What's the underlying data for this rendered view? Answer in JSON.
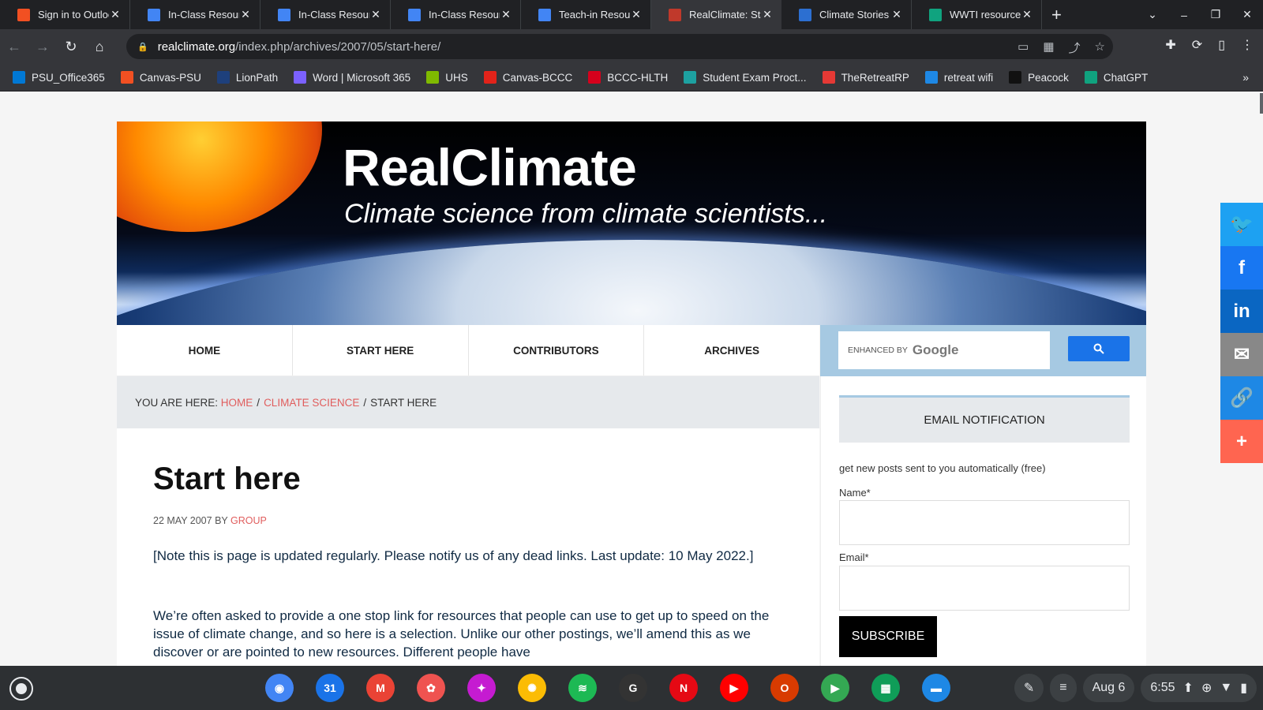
{
  "browser": {
    "tabs": [
      {
        "title": "Sign in to Outlook",
        "icon": "microsoft-icon",
        "active": false
      },
      {
        "title": "In-Class Resources",
        "icon": "docs-icon",
        "active": false
      },
      {
        "title": "In-Class Resources",
        "icon": "docs-icon",
        "active": false
      },
      {
        "title": "In-Class Resources",
        "icon": "docs-icon",
        "active": false
      },
      {
        "title": "Teach-in Resources",
        "icon": "docs-icon",
        "active": false
      },
      {
        "title": "RealClimate: Start here",
        "icon": "realclimate-icon",
        "active": true
      },
      {
        "title": "Climate Stories",
        "icon": "climate-stories-icon",
        "active": false
      },
      {
        "title": "WWTI resources",
        "icon": "chatgpt-icon",
        "active": false
      }
    ],
    "url_host": "realclimate.org",
    "url_path": "/index.php/archives/2007/05/start-here/",
    "bookmarks": [
      {
        "label": "PSU_Office365",
        "icon": "outlook-icon",
        "color": "#0078d4"
      },
      {
        "label": "Canvas-PSU",
        "icon": "microsoft-icon",
        "color": "#f25022"
      },
      {
        "label": "LionPath",
        "icon": "lionpath-icon",
        "color": "#1e407c"
      },
      {
        "label": "Word | Microsoft 365",
        "icon": "m365-icon",
        "color": "#7b61ff"
      },
      {
        "label": "UHS",
        "icon": "microsoft-icon",
        "color": "#7fba00"
      },
      {
        "label": "Canvas-BCCC",
        "icon": "canvas-icon",
        "color": "#e2231a"
      },
      {
        "label": "BCCC-HLTH",
        "icon": "mcgraw-hill-icon",
        "color": "#d6001c"
      },
      {
        "label": "Student Exam Proct...",
        "icon": "proctor-icon",
        "color": "#1da1a1"
      },
      {
        "label": "TheRetreatRP",
        "icon": "retreat-icon",
        "color": "#e53935"
      },
      {
        "label": "retreat wifi",
        "icon": "wifi-icon",
        "color": "#1e88e5"
      },
      {
        "label": "Peacock",
        "icon": "peacock-icon",
        "color": "#111111"
      },
      {
        "label": "ChatGPT",
        "icon": "chatgpt-icon",
        "color": "#10a37f"
      }
    ]
  },
  "site": {
    "title": "RealClimate",
    "tagline": "Climate science from climate scientists...",
    "nav": [
      "HOME",
      "START HERE",
      "CONTRIBUTORS",
      "ARCHIVES"
    ],
    "search_enhanced": "ENHANCED BY",
    "search_brand": "Google"
  },
  "breadcrumb": {
    "prefix": "YOU ARE HERE:",
    "home": "HOME",
    "category": "CLIMATE SCIENCE",
    "current": "START HERE"
  },
  "article": {
    "title": "Start here",
    "date": "22 MAY 2007",
    "by": "BY",
    "author": "GROUP",
    "paragraphs": [
      "[Note this is page is updated regularly. Please notify us of any dead links. Last update: 10 May 2022.]",
      "We’re often asked to provide a one stop link for resources that people can use to get up to speed on the issue of climate change, and so here is a selection. Unlike our other postings, we’ll amend this as we discover or are pointed to new resources. Different people have"
    ]
  },
  "sidebar": {
    "heading": "EMAIL NOTIFICATION",
    "description": "get new posts sent to you automatically (free)",
    "name_label": "Name*",
    "email_label": "Email*",
    "subscribe": "SUBSCRIBE"
  },
  "share_buttons": [
    {
      "icon": "twitter-icon",
      "color": "#1da1f2"
    },
    {
      "icon": "facebook-icon",
      "color": "#1877f2"
    },
    {
      "icon": "linkedin-icon",
      "color": "#0a66c2"
    },
    {
      "icon": "email-icon",
      "color": "#888888"
    },
    {
      "icon": "link-icon",
      "color": "#1e88e5"
    },
    {
      "icon": "plus-icon",
      "color": "#ff6550"
    }
  ],
  "shelf": {
    "apps": [
      {
        "icon": "chrome-icon",
        "color": "#4285f4"
      },
      {
        "icon": "calendar-icon",
        "color": "#1a73e8"
      },
      {
        "icon": "gmail-icon",
        "color": "#ea4335"
      },
      {
        "icon": "paint-icon",
        "color": "#ef5350"
      },
      {
        "icon": "gallery-icon",
        "color": "#c51bd1"
      },
      {
        "icon": "photos-icon",
        "color": "#fbbc04"
      },
      {
        "icon": "spotify-icon",
        "color": "#1db954"
      },
      {
        "icon": "grammarly-icon",
        "color": "#333333"
      },
      {
        "icon": "netflix-icon",
        "color": "#e50914"
      },
      {
        "icon": "youtube-icon",
        "color": "#ff0000"
      },
      {
        "icon": "office-icon",
        "color": "#d83b01"
      },
      {
        "icon": "play-store-icon",
        "color": "#34a853"
      },
      {
        "icon": "sheets-icon",
        "color": "#0f9d58"
      },
      {
        "icon": "files-icon",
        "color": "#1e88e5"
      }
    ],
    "date": "Aug 6",
    "time": "6:55"
  }
}
